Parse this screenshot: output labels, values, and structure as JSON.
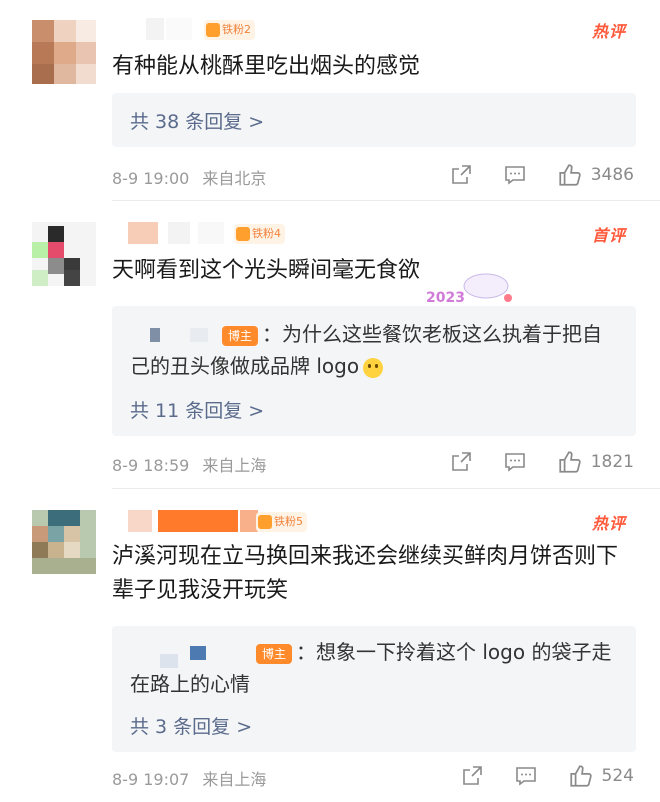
{
  "comments": [
    {
      "badge": "铁粉2",
      "tag": "热评",
      "text": "有种能从桃酥里吃出烟头的感觉",
      "reply_more": "共 38 条回复 >",
      "time": "8-9 19:00",
      "location": "来自北京",
      "likes": "3486"
    },
    {
      "badge": "铁粉4",
      "tag": "首评",
      "text": "天啊看到这个光头瞬间毫无食欲",
      "sticker_text": "2023",
      "reply_host": "博主",
      "reply_text": "：为什么这些餐饮老板这么执着于把自己的丑头像做成品牌 logo",
      "reply_more": "共 11 条回复 >",
      "time": "8-9 18:59",
      "location": "来自上海",
      "likes": "1821"
    },
    {
      "badge": "铁粉5",
      "tag": "热评",
      "text": "泸溪河现在立马换回来我还会继续买鲜肉月饼否则下辈子见我没开玩笑",
      "reply_host": "博主",
      "reply_text": "：想象一下拎着这个 logo 的袋子走在路上的心情",
      "reply_more": "共 3 条回复 >",
      "time": "8-9 19:07",
      "location": "来自上海",
      "likes": "524"
    }
  ],
  "icons": {
    "share": "share-icon",
    "comment": "comment-icon",
    "like": "thumbs-up-icon"
  },
  "colors": {
    "hot_tag": "#ff5a3c",
    "link": "#5a6b8c",
    "host_tag": "#ff8a2b"
  }
}
